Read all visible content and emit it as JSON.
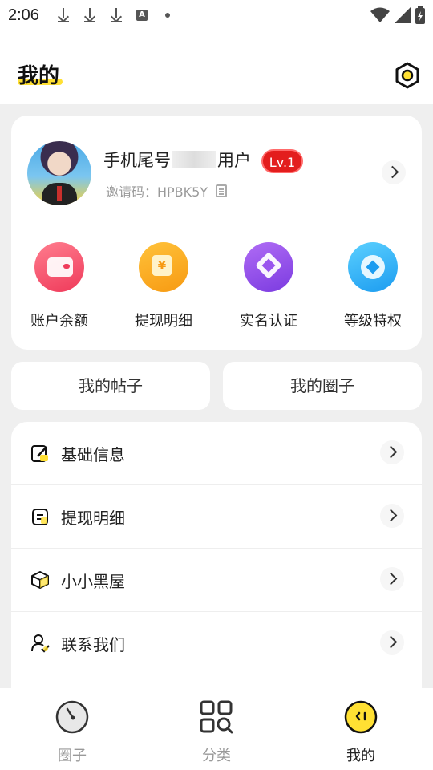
{
  "status_bar": {
    "time": "2:06",
    "notification_icons": [
      "download-icon",
      "download-icon",
      "download-icon",
      "a-icon",
      "dot-icon"
    ],
    "right_icons": [
      "wifi-icon",
      "signal-icon",
      "battery-icon"
    ]
  },
  "header": {
    "title": "我的",
    "accent_color": "#ffe033"
  },
  "profile": {
    "name_prefix": "手机尾号",
    "name_suffix": "用户",
    "level": "Lv.1",
    "invite_code": "邀请码：HPBK5Y"
  },
  "quick_actions": [
    {
      "label": "账户余额",
      "icon": "wallet-icon"
    },
    {
      "label": "提现明细",
      "icon": "yen-icon"
    },
    {
      "label": "实名认证",
      "icon": "diamond-icon"
    },
    {
      "label": "等级特权",
      "icon": "badge-icon"
    }
  ],
  "tabs": {
    "my_posts": "我的帖子",
    "my_circles": "我的圈子"
  },
  "menu": [
    {
      "label": "基础信息",
      "icon": "edit-icon"
    },
    {
      "label": "提现明细",
      "icon": "document-icon"
    },
    {
      "label": "小小黑屋",
      "icon": "cube-icon"
    },
    {
      "label": "联系我们",
      "icon": "contact-icon"
    }
  ],
  "bottom_nav": [
    {
      "label": "圈子",
      "icon": "compass-icon",
      "active": false
    },
    {
      "label": "分类",
      "icon": "category-icon",
      "active": false
    },
    {
      "label": "我的",
      "icon": "profile-face-icon",
      "active": true
    }
  ]
}
